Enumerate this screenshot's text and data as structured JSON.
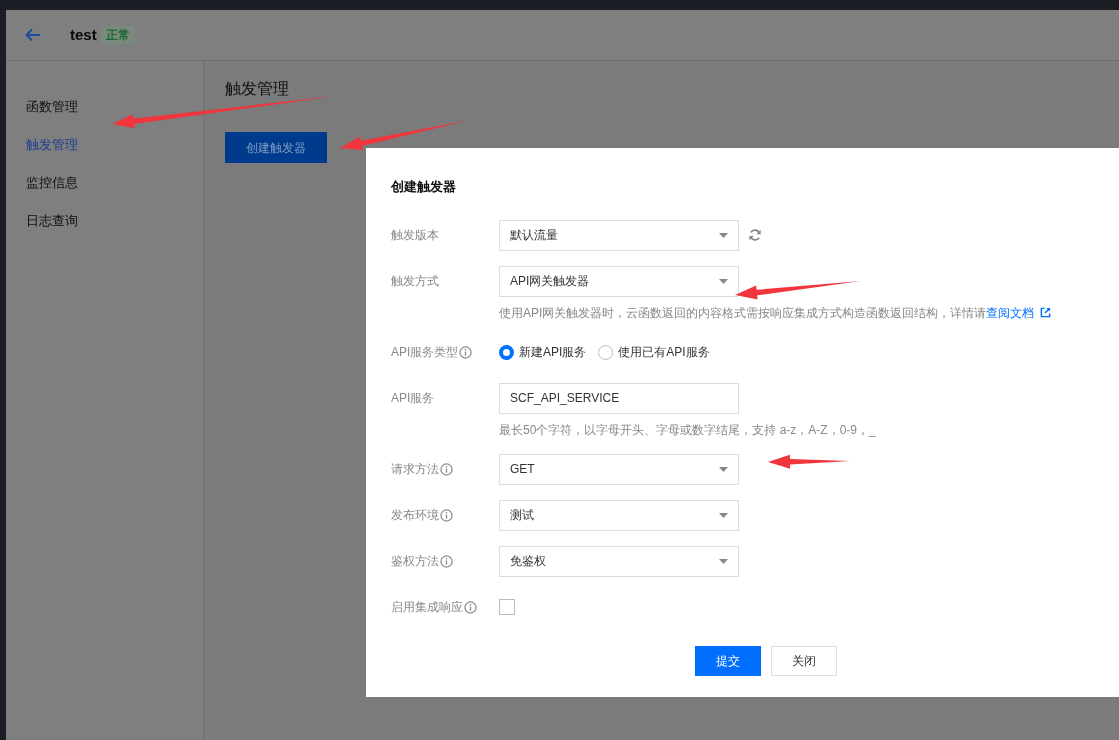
{
  "header": {
    "title": "test",
    "status": "正常"
  },
  "sidebar": {
    "items": [
      {
        "label": "函数管理",
        "selected": false
      },
      {
        "label": "触发管理",
        "selected": true
      },
      {
        "label": "监控信息",
        "selected": false
      },
      {
        "label": "日志查询",
        "selected": false
      }
    ]
  },
  "content": {
    "title": "触发管理",
    "create_button": "创建触发器"
  },
  "dialog": {
    "title": "创建触发器",
    "fields": [
      {
        "kind": "select",
        "label": "触发版本",
        "info": false,
        "value": "默认流量",
        "refresh": true
      },
      {
        "kind": "select",
        "label": "触发方式",
        "info": false,
        "value": "API网关触发器",
        "help": "使用API网关触发器时，云函数返回的内容格式需按响应集成方式构造函数返回结构，详情请",
        "help_link": "查阅文档"
      },
      {
        "kind": "radio",
        "label": "API服务类型",
        "info": true,
        "options": [
          {
            "label": "新建API服务",
            "selected": true
          },
          {
            "label": "使用已有API服务",
            "selected": false
          }
        ]
      },
      {
        "kind": "text",
        "label": "API服务",
        "info": false,
        "value": "SCF_API_SERVICE",
        "help": "最长50个字符，以字母开头、字母或数字结尾，支持 a-z，A-Z，0-9，_"
      },
      {
        "kind": "select",
        "label": "请求方法",
        "info": true,
        "value": "GET"
      },
      {
        "kind": "select",
        "label": "发布环境",
        "info": true,
        "value": "测试"
      },
      {
        "kind": "select",
        "label": "鉴权方法",
        "info": true,
        "value": "免鉴权"
      },
      {
        "kind": "checkbox",
        "label": "启用集成响应",
        "info": true,
        "checked": false
      }
    ],
    "buttons": [
      {
        "label": "提交",
        "primary": true
      },
      {
        "label": "关闭",
        "primary": false
      }
    ]
  }
}
